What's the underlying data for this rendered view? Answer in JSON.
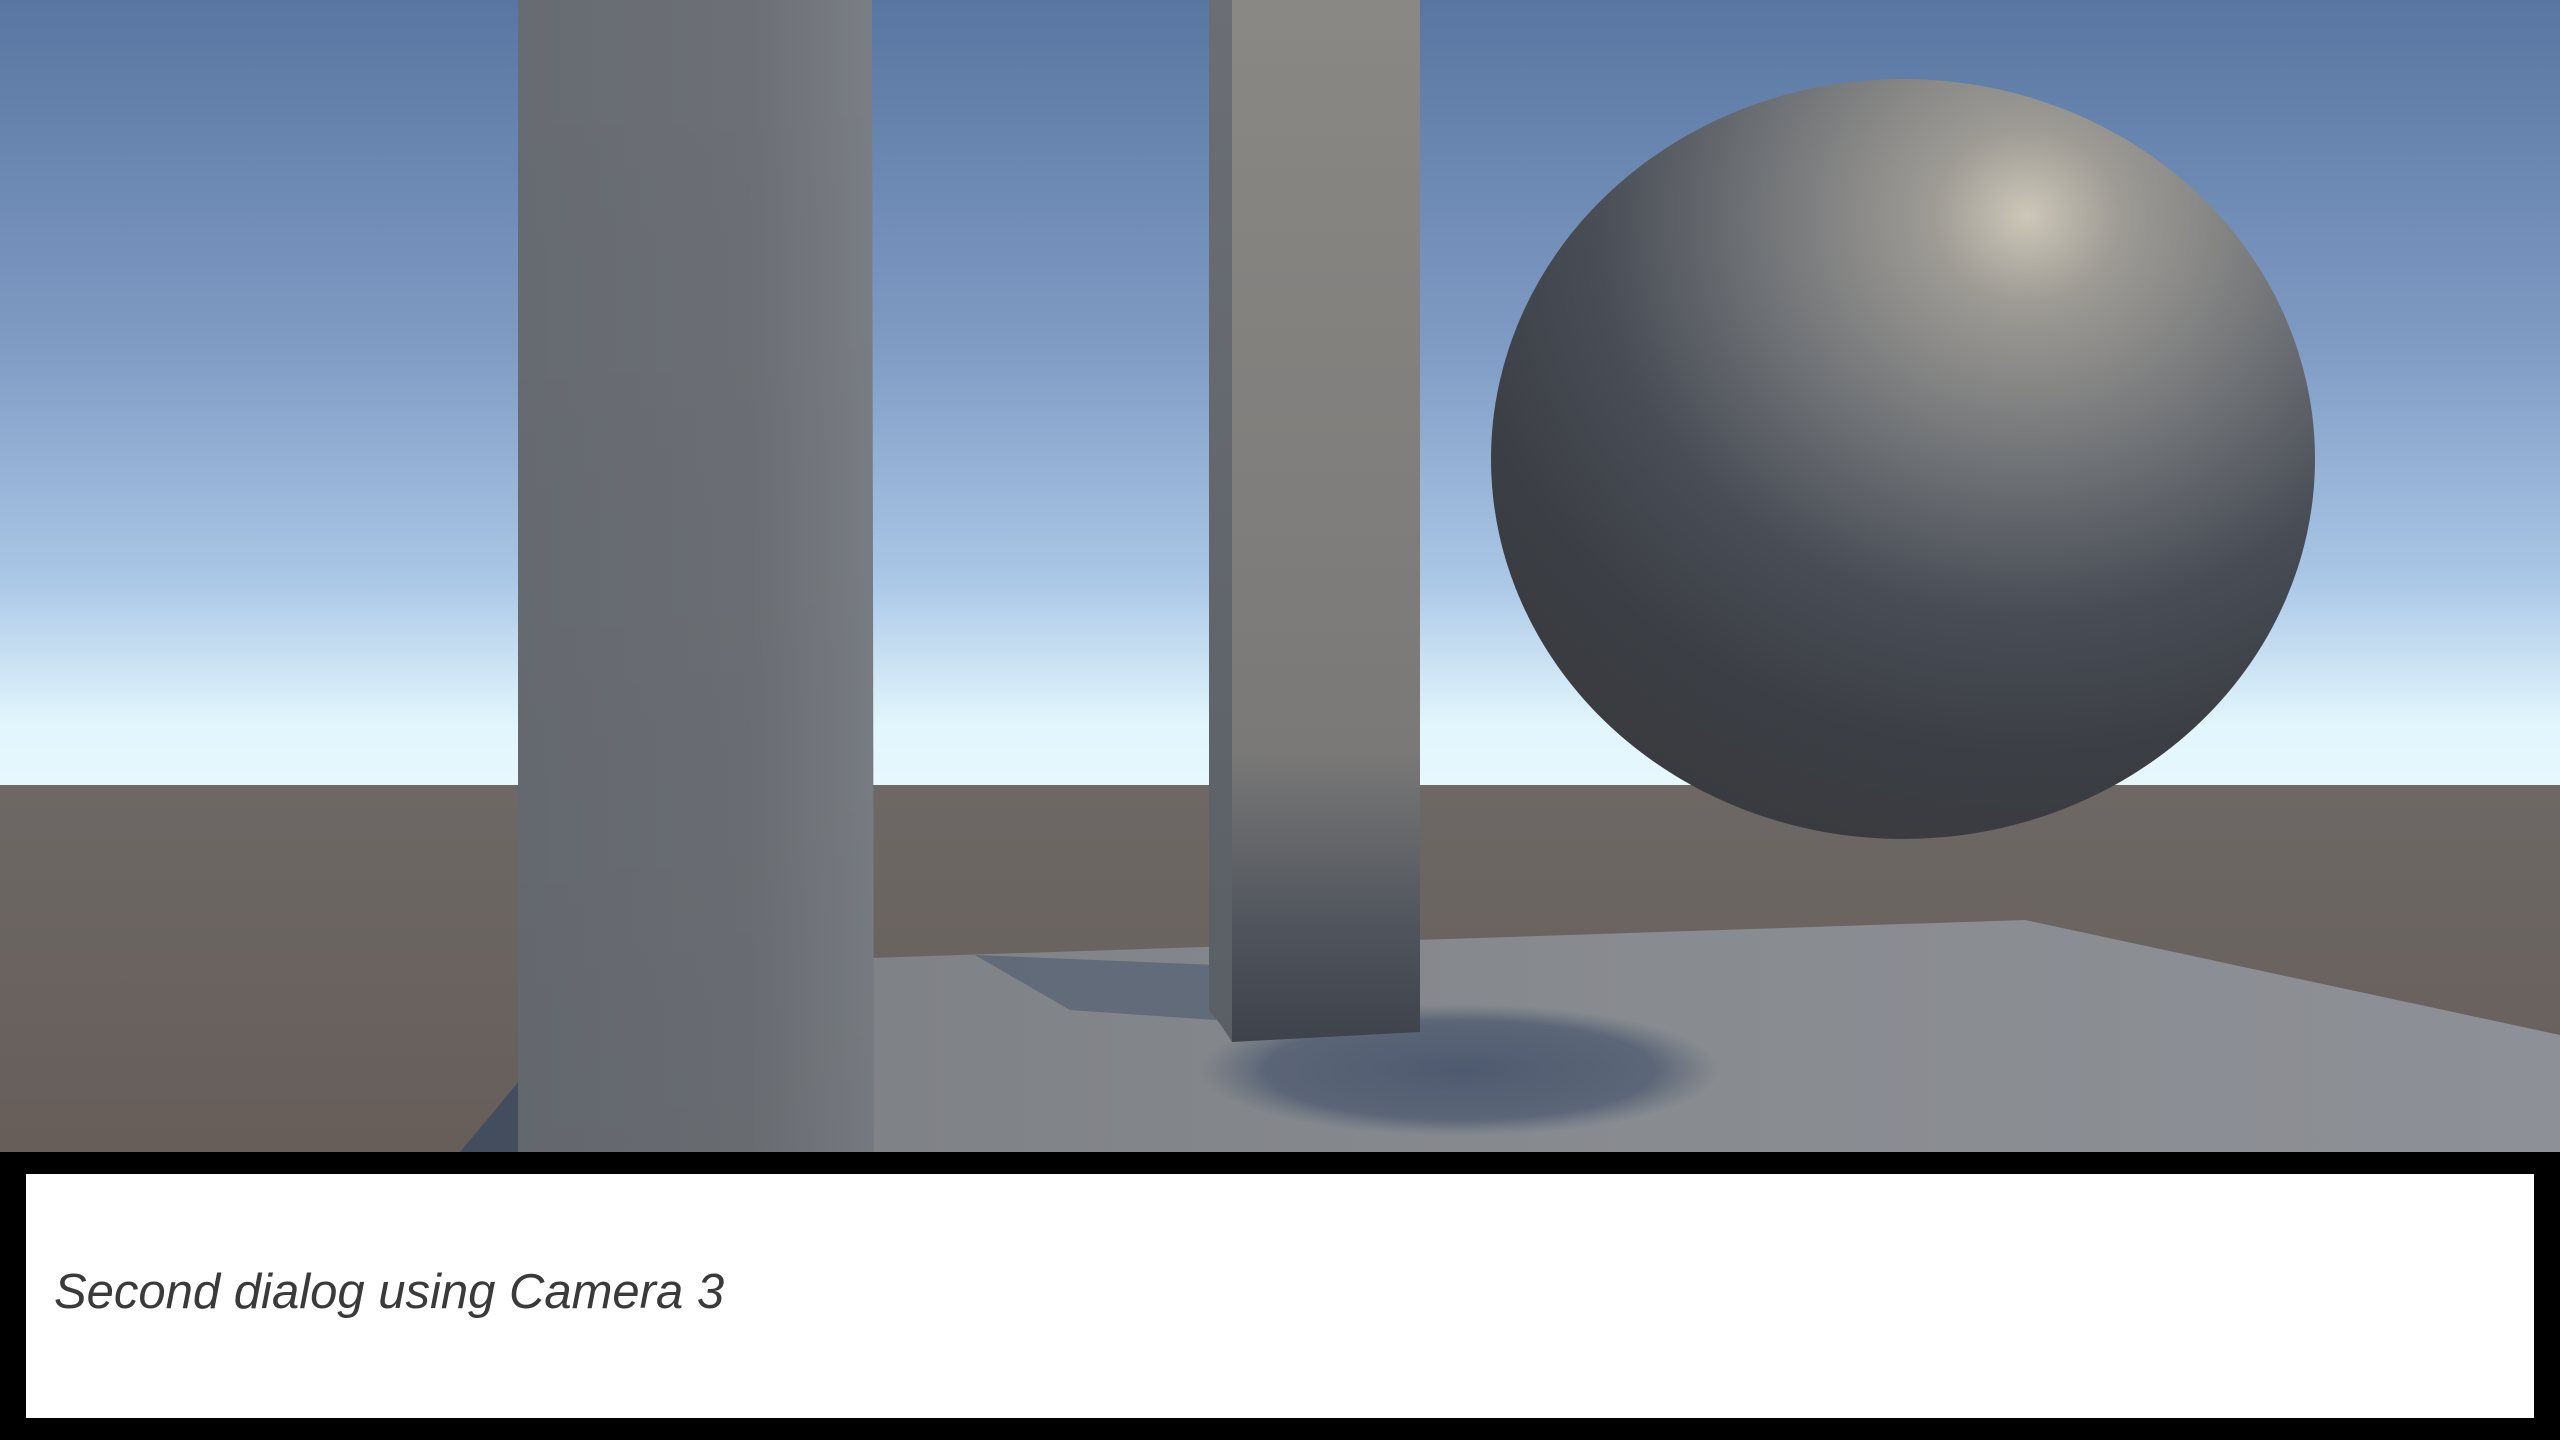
{
  "scene": {
    "objects": [
      "wall-left",
      "pillar-center",
      "sphere",
      "floor-plane"
    ],
    "colors": {
      "sky_top": "#5877a2",
      "sky_horizon": "#eafbff",
      "ground": "#6a625f",
      "floor": "#8a8d92",
      "wall": "#676c73",
      "sphere_shadow": "#35383d"
    }
  },
  "dialog": {
    "text": "Second dialog using Camera 3",
    "colors": {
      "frame": "#000000",
      "box": "#ffffff",
      "text": "#3a3a3a"
    }
  }
}
